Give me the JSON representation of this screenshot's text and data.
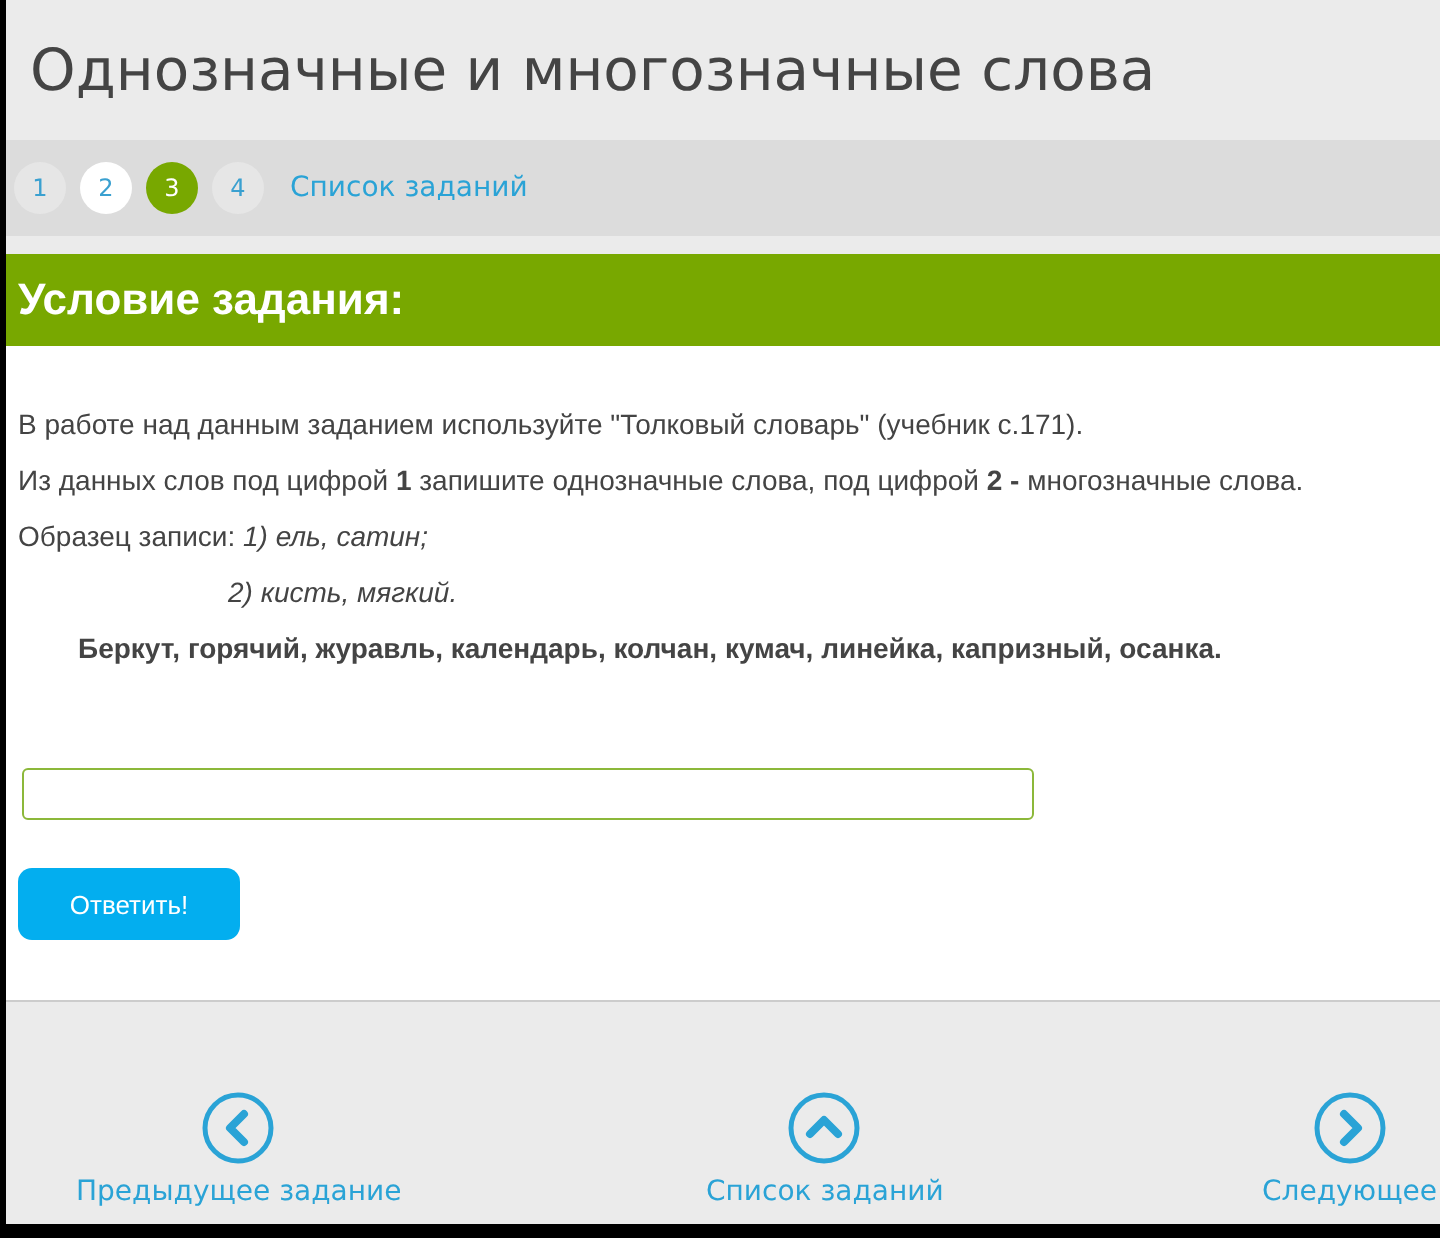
{
  "title": "Однозначные и многозначные слова",
  "pager": {
    "items": [
      {
        "label": "1",
        "selected": false,
        "highlighted": false
      },
      {
        "label": "2",
        "selected": false,
        "highlighted": true
      },
      {
        "label": "3",
        "selected": true,
        "highlighted": false
      },
      {
        "label": "4",
        "selected": false,
        "highlighted": false
      }
    ],
    "list_link": "Список заданий"
  },
  "task": {
    "heading": "Условие задания:",
    "paragraphs": [
      {
        "text": "В работе над данным заданием используйте \"Толковый словарь\" (учебник с.171).",
        "kind": "plain"
      },
      {
        "text": "Из данных слов под цифрой **1** запишите однозначные слова, под цифрой **2 -** многозначные слова.",
        "kind": "plain"
      },
      {
        "text": "Образец записи: *1) ель, сатин;*",
        "kind": "plain"
      },
      {
        "text": "2) кисть, мягкий.",
        "kind": "example"
      },
      {
        "text": "Беркут, горячий, журавль, календарь, колчан, кумач, линейка, капризный, осанка.",
        "kind": "words"
      }
    ],
    "answer_button": "Ответить!"
  },
  "nav": [
    {
      "label": "Предыдущее задание",
      "kind": "prev"
    },
    {
      "label": "Список заданий",
      "kind": "up"
    },
    {
      "label": "Следующее",
      "kind": "next"
    }
  ]
}
